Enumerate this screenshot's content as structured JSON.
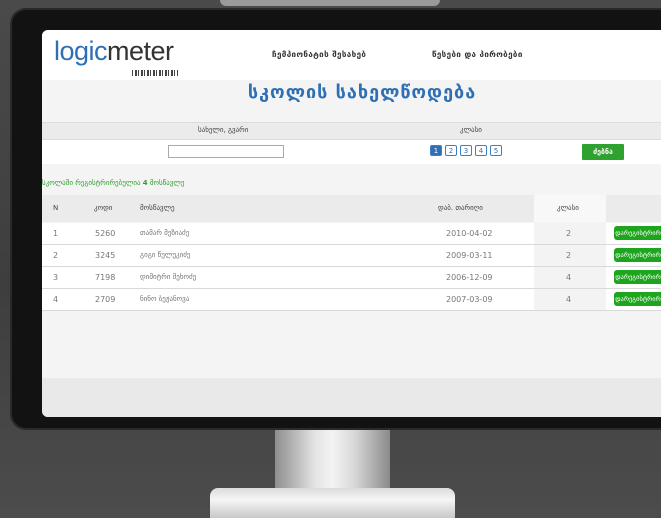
{
  "header": {
    "logo_part1": "logic",
    "logo_part2": "meter",
    "nav": [
      "ჩემპიონატის შესახებ",
      "წესები და პირობები"
    ]
  },
  "page_title": "სკოლის სახელწოდება",
  "filter": {
    "name_label": "სახელი, გვარი",
    "class_label": "კლასი",
    "name_value": "",
    "class_buttons": [
      "1",
      "2",
      "3",
      "4",
      "5"
    ],
    "active_class": "1",
    "search_label": "ძებნა"
  },
  "count_text_before": "სკოლაში რეგისტრირებულია",
  "count_value": "4",
  "count_text_after": "მოსწავლე",
  "table": {
    "columns": [
      "N",
      "კოდი",
      "მოსწავლე",
      "დაბ. თარიღი",
      "კლასი"
    ],
    "rows": [
      {
        "n": "1",
        "code": "5260",
        "student": "თამარ მეზიაძე",
        "dob": "2010-04-02",
        "grade": "2",
        "action": "დარეგისტრირება"
      },
      {
        "n": "2",
        "code": "3245",
        "student": "გიგი წულუკიძე",
        "dob": "2009-03-11",
        "grade": "2",
        "action": "დარეგისტრირება"
      },
      {
        "n": "3",
        "code": "7198",
        "student": "დიმიტრი მეხოძე",
        "dob": "2006-12-09",
        "grade": "4",
        "action": "დარეგისტრირება"
      },
      {
        "n": "4",
        "code": "2709",
        "student": "ნინო ბეჟანოვა",
        "dob": "2007-03-09",
        "grade": "4",
        "action": "დარეგისტრირება"
      }
    ]
  },
  "colors": {
    "brand_blue": "#2f6fb3",
    "green": "#1ea51e"
  }
}
